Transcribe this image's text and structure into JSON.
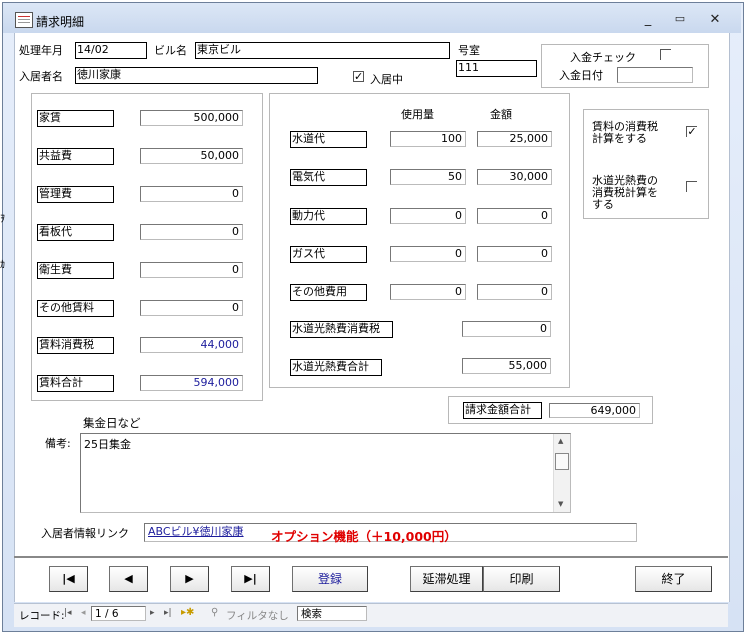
{
  "window": {
    "title": "請求明細",
    "controls": [
      "−",
      "□",
      "✕"
    ]
  },
  "header": {
    "period_label": "処理年月",
    "period_value": "14/02",
    "building_label": "ビル名",
    "building_value": "東京ビル",
    "room_label": "号室",
    "room_value": "111",
    "tenant_label": "入居者名",
    "tenant_value": "徳川家康",
    "resident_label": "入居中",
    "resident_checked": true
  },
  "payment": {
    "check_label": "入金チェック",
    "date_label": "入金日付",
    "date_value": ""
  },
  "rent_items": [
    {
      "label": "家賃",
      "value": "500,000"
    },
    {
      "label": "共益費",
      "value": "50,000"
    },
    {
      "label": "管理費",
      "value": "0"
    },
    {
      "label": "看板代",
      "value": "0"
    },
    {
      "label": "衛生費",
      "value": "0"
    },
    {
      "label": "その他賃料",
      "value": "0"
    },
    {
      "label": "賃料消費税",
      "value": "44,000"
    },
    {
      "label": "賃料合計",
      "value": "594,000"
    }
  ],
  "utilities": {
    "usage_header": "使用量",
    "amount_header": "金額",
    "rows": [
      {
        "label": "水道代",
        "usage": "100",
        "amount": "25,000"
      },
      {
        "label": "電気代",
        "usage": "50",
        "amount": "30,000"
      },
      {
        "label": "動力代",
        "usage": "0",
        "amount": "0"
      },
      {
        "label": "ガス代",
        "usage": "0",
        "amount": "0"
      },
      {
        "label": "その他費用",
        "usage": "0",
        "amount": "0"
      }
    ],
    "tax_label": "水道光熱費消費税",
    "tax_value": "0",
    "total_label": "水道光熱費合計",
    "total_value": "55,000"
  },
  "tax_options": {
    "rent_tax_label": "賃料の消費税\n計算をする",
    "rent_tax_checked": true,
    "util_tax_label": "水道光熱費の\n消費税計算を\nする",
    "util_tax_checked": false
  },
  "billing_total": {
    "label": "請求金額合計",
    "value": "649,000"
  },
  "notes": {
    "caption": "集金日など",
    "label": "備考:",
    "value": "25日集金"
  },
  "link": {
    "label": "入居者情報リンク",
    "value": "ABCビル¥徳川家康",
    "option_text": "オプション機能（＋10,000円）"
  },
  "buttons": {
    "first": "|◀",
    "prev": "◀",
    "next": "▶",
    "last": "▶|",
    "register": "登録",
    "late": "延滞処理",
    "print": "印刷",
    "exit": "終了"
  },
  "statusbar": {
    "record_label": "レコード:",
    "record_value": "1 / 6",
    "filter_label": "フィルタなし",
    "search_label": "検索"
  },
  "colors": {
    "link_blue": "#1c1c9c",
    "option_red": "#e00000",
    "title_bg": "#d3e0f3"
  }
}
